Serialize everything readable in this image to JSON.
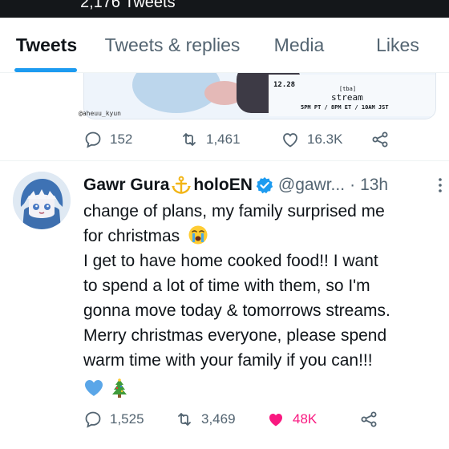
{
  "header": {
    "tweet_count": "2,176 Tweets"
  },
  "tabs": [
    {
      "label": "Tweets",
      "active": true
    },
    {
      "label": "Tweets & replies",
      "active": false
    },
    {
      "label": "Media",
      "active": false
    },
    {
      "label": "Likes",
      "active": false
    }
  ],
  "previous_tweet": {
    "media": {
      "date": "12.28",
      "tag": "[tba]",
      "title": "stream",
      "times": "5PM PT / 8PM ET / 10AM JST",
      "credit": "@aheuu_kyun"
    },
    "replies": "152",
    "retweets": "1,461",
    "likes": "16.3K"
  },
  "tweet": {
    "display_name": "Gawr Gura",
    "name_suffix": "holoEN",
    "handle": "@gawr...",
    "separator": "·",
    "time": "13h",
    "lines": [
      "change of plans, my family surprised me",
      "for christmas",
      "I get to have home cooked food!! I want",
      "to spend a lot of time with them, so I'm",
      "gonna move today & tomorrows streams.",
      "Merry christmas everyone, please spend",
      "warm time with your family if you can!!!"
    ],
    "replies": "1,525",
    "retweets": "3,469",
    "likes": "48K",
    "liked": true,
    "icons": [
      "crying-face-emoji",
      "blue-heart-emoji",
      "christmas-tree-emoji",
      "anchor-icon",
      "verified-badge-icon"
    ]
  },
  "colors": {
    "accent": "#1d9bf0",
    "like": "#f91880",
    "muted": "#536471"
  }
}
